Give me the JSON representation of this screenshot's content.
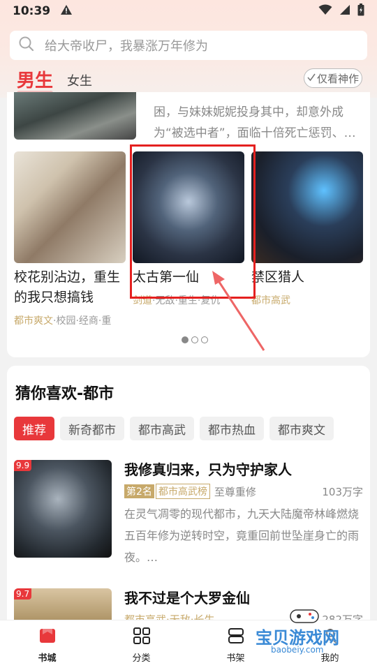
{
  "status": {
    "time": "10:39"
  },
  "search": {
    "placeholder": "给大帝收尸，我暴涨万年修为"
  },
  "tabs": {
    "male": "男生",
    "female": "女生"
  },
  "filter": {
    "only_god": "仅看神作"
  },
  "top_book": {
    "desc": "困，与妹妹妮妮投身其中，却意外成为“被选中者”，面临十倍死亡惩罚、…"
  },
  "books": [
    {
      "title": "校花别沾边，重生的我只想搞钱",
      "tags_hl": "都市爽文",
      "tags_rest": "·校园·经商·重"
    },
    {
      "title": "太古第一仙",
      "tags_hl": "剑道",
      "tags_rest": "·无敌·重生·复仇"
    },
    {
      "title": "禁区猎人",
      "tags_hl": "都市高武",
      "tags_rest": ""
    }
  ],
  "section": {
    "title": "猜你喜欢-都市",
    "chips": [
      "推荐",
      "新奇都市",
      "都市高武",
      "都市热血",
      "都市爽文"
    ]
  },
  "list": [
    {
      "score": "9.9",
      "title": "我修真归来，只为守护家人",
      "rank": "第2名",
      "rank_list": "都市高武榜",
      "author": "至尊重修",
      "words": "103万字",
      "desc": "在灵气凋零的现代都市，九天大陆魔帝林峰燃烧五百年修为逆转时空，竟重回前世坠崖身亡的雨夜。…"
    },
    {
      "score": "9.7",
      "title": "我不过是个大罗金仙",
      "tags": "都市高武·无敌·长生",
      "words": "282万字"
    }
  ],
  "nav": [
    "书城",
    "分类",
    "书架",
    "我的"
  ],
  "watermark": {
    "text": "宝贝游戏网",
    "url": "baobeiy.com"
  }
}
